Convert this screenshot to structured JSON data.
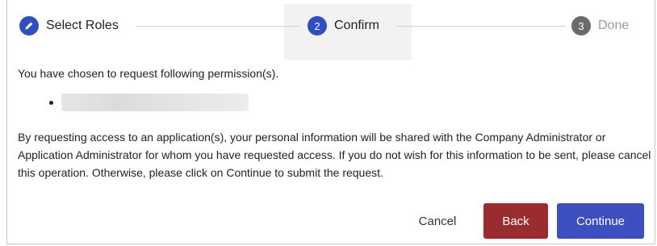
{
  "stepper": {
    "steps": [
      {
        "number": "",
        "icon": "pencil-icon",
        "label": "Select Roles",
        "state": "done"
      },
      {
        "number": "2",
        "label": "Confirm",
        "state": "active"
      },
      {
        "number": "3",
        "label": "Done",
        "state": "pending"
      }
    ]
  },
  "content": {
    "intro": "You have chosen to request following permission(s).",
    "permissions": [
      "[redacted]"
    ],
    "disclaimer": "By requesting access to an application(s), your personal information will be shared with the Company Administrator or Application Administrator for whom you have requested access. If you do not wish for this information to be sent, please cancel this operation. Otherwise, please click on Continue to submit the request."
  },
  "actions": {
    "cancel_label": "Cancel",
    "back_label": "Back",
    "continue_label": "Continue"
  },
  "colors": {
    "primary": "#3d4fbf",
    "back": "#9a2b2f",
    "pending": "#6b6b6b",
    "active_step_bg": "#f2f2f2"
  }
}
